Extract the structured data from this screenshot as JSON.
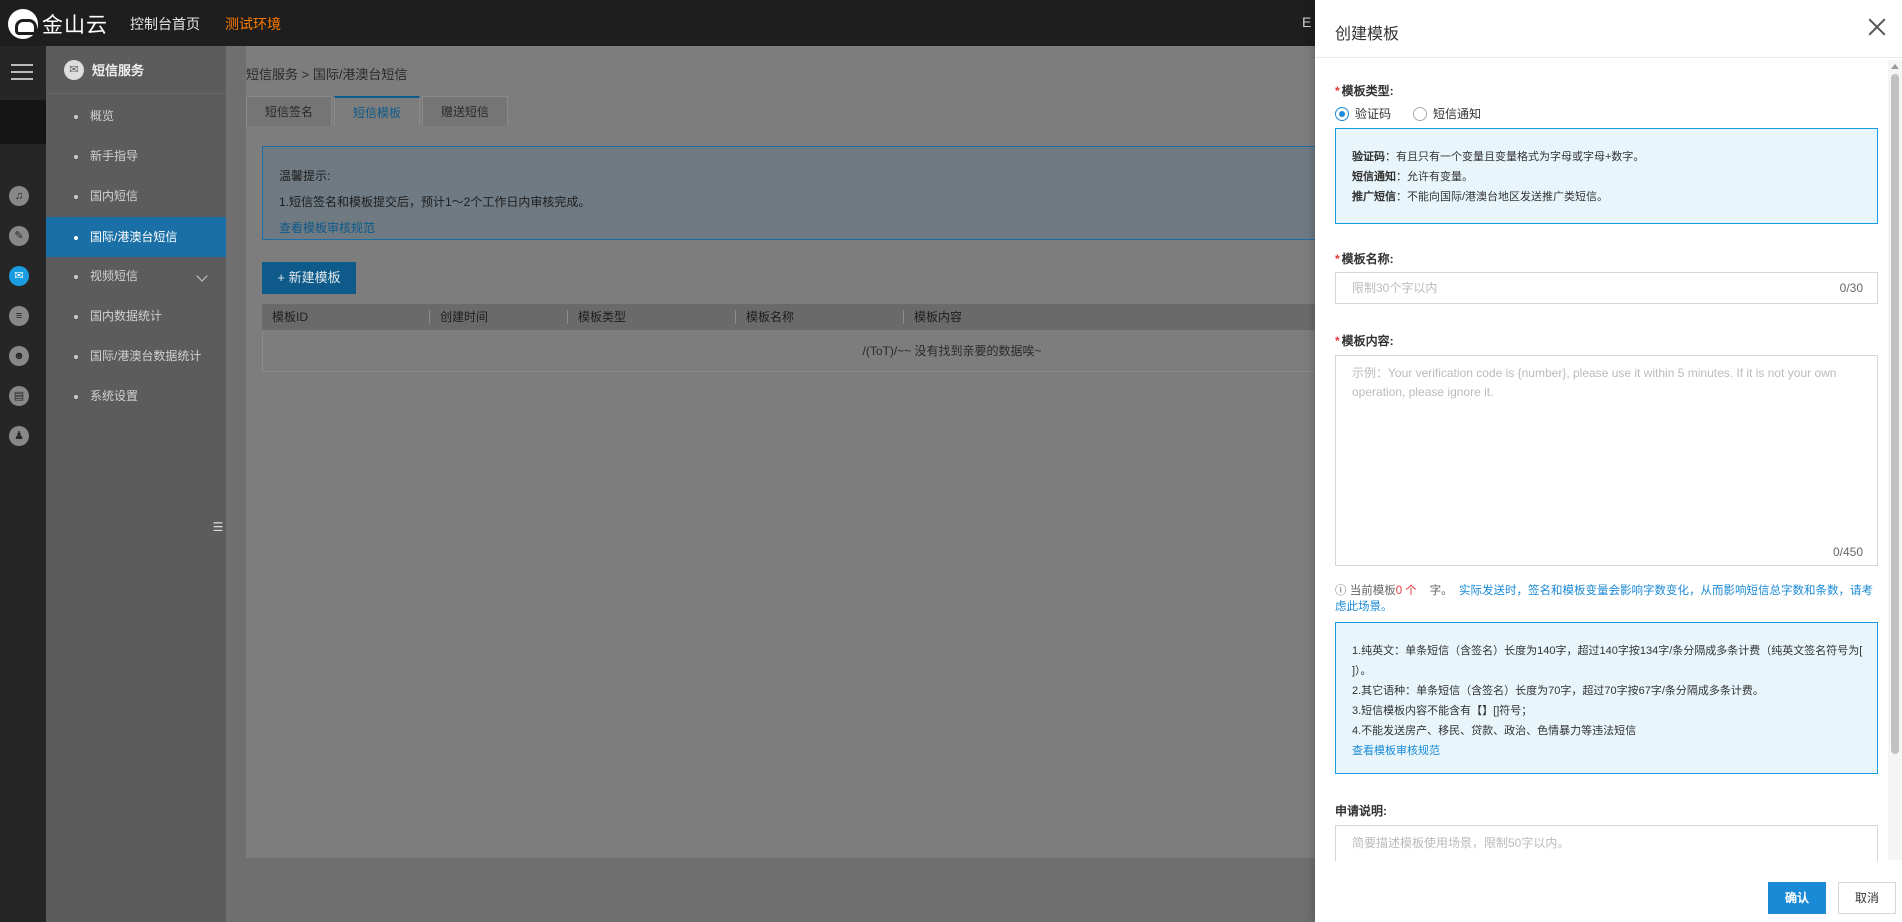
{
  "topbar": {
    "logo_text": "金山云",
    "console_home": "控制台首页",
    "env": "测试环境",
    "right_partial": "E"
  },
  "rail": {
    "menu_icon": "menu-icon",
    "icons": [
      "voice-icon",
      "badge-icon",
      "mail-icon",
      "list-icon",
      "robot-icon",
      "id-card-icon",
      "user-group-icon"
    ]
  },
  "sidebar": {
    "title": "短信服务",
    "items": [
      {
        "label": "概览"
      },
      {
        "label": "新手指导"
      },
      {
        "label": "国内短信"
      },
      {
        "label": "国际/港澳台短信"
      },
      {
        "label": "视频短信"
      },
      {
        "label": "国内数据统计"
      },
      {
        "label": "国际/港澳台数据统计"
      },
      {
        "label": "系统设置"
      }
    ]
  },
  "main": {
    "breadcrumb": "短信服务  >  国际/港澳台短信",
    "tabs": [
      {
        "label": "短信签名"
      },
      {
        "label": "短信模板"
      },
      {
        "label": "赠送短信"
      }
    ],
    "notice": {
      "title": "温馨提示:",
      "line1": "1.短信签名和模板提交后，预计1～2个工作日内审核完成。",
      "link": "查看模板审核规范"
    },
    "new_button": "+ 新建模板",
    "columns": [
      "模板ID",
      "创建时间",
      "模板类型",
      "模板名称",
      "模板内容"
    ],
    "empty_text": "/(ToT)/~~ 没有找到亲要的数据唉~"
  },
  "drawer": {
    "title": "创建模板",
    "type_label": "模板类型:",
    "type_options": [
      {
        "label": "验证码",
        "checked": true
      },
      {
        "label": "短信通知",
        "checked": false
      }
    ],
    "type_info": {
      "line1_key": "验证码",
      "line1_val": "：有且只有一个变量且变量格式为字母或字母+数字。",
      "line2_key": "短信通知",
      "line2_val": "：允许有变量。",
      "line3_key": "推广短信",
      "line3_val": "：不能向国际/港澳台地区发送推广类短信。"
    },
    "name_label": "模板名称:",
    "name_placeholder": "限制30个字以内",
    "name_count": "0/30",
    "content_label": "模板内容:",
    "content_placeholder": "示例：Your verification code is {number}, please use it within 5 minutes. If it is not your own operation, please ignore it.",
    "content_count": "0/450",
    "hint_prefix": "ⓘ  当前模板",
    "hint_count": "0 个",
    "hint_unit": "字。",
    "hint_blue": "实际发送时，签名和模板变量会影响字数变化，从而影响短信总字数和条数，请考虑此场景。",
    "rules": [
      "1.纯英文：单条短信（含签名）长度为140字，超过140字按134字/条分隔成多条计费（纯英文签名符号为[ ]）。",
      "2.其它语种：单条短信（含签名）长度为70字，超过70字按67字/条分隔成多条计费。",
      "3.短信模板内容不能含有【】[]符号；",
      "4.不能发送房产、移民、贷款、政治、色情暴力等违法短信"
    ],
    "rules_link": "查看模板审核规范",
    "apply_label": "申请说明:",
    "apply_placeholder": "简要描述模板使用场景，限制50字以内。",
    "ok_button": "确认",
    "cancel_button": "取消"
  },
  "colors": {
    "accent": "#1a8ad6",
    "required": "#e4393c",
    "env": "#ff7a00"
  }
}
